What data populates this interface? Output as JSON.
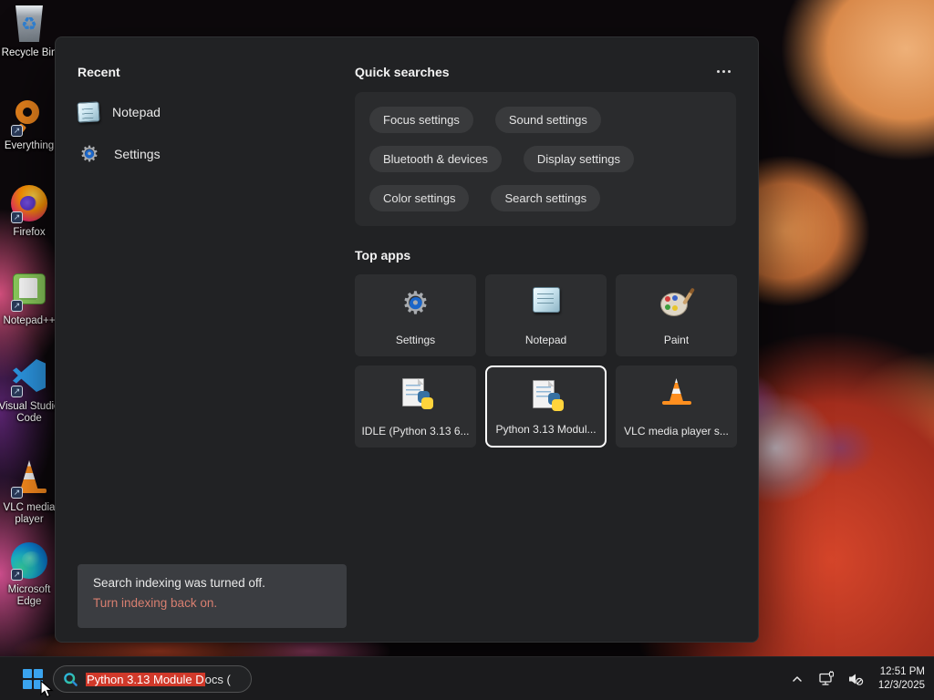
{
  "desktop": {
    "icons": [
      {
        "name": "recycle-bin",
        "label": "Recycle Bin"
      },
      {
        "name": "everything",
        "label": "Everything"
      },
      {
        "name": "firefox",
        "label": "Firefox"
      },
      {
        "name": "notepad-plus-plus",
        "label": "Notepad++"
      },
      {
        "name": "visual-studio-code",
        "label": "Visual Studio Code"
      },
      {
        "name": "vlc-media-player",
        "label": "VLC media player"
      },
      {
        "name": "microsoft-edge",
        "label": "Microsoft Edge"
      }
    ]
  },
  "panel": {
    "recent": {
      "title": "Recent",
      "items": [
        {
          "label": "Notepad"
        },
        {
          "label": "Settings"
        }
      ]
    },
    "quick_searches": {
      "title": "Quick searches",
      "pills": [
        "Focus settings",
        "Sound settings",
        "Bluetooth & devices",
        "Display settings",
        "Color settings",
        "Search settings"
      ]
    },
    "top_apps": {
      "title": "Top apps",
      "tiles": [
        {
          "label": "Settings",
          "selected": false
        },
        {
          "label": "Notepad",
          "selected": false
        },
        {
          "label": "Paint",
          "selected": false
        },
        {
          "label": "IDLE (Python 3.13 6...",
          "selected": false
        },
        {
          "label": "Python 3.13 Modul...",
          "selected": true
        },
        {
          "label": "VLC media player s...",
          "selected": false
        }
      ]
    },
    "notice": {
      "line1": "Search indexing was turned off.",
      "line2": "Turn indexing back on."
    }
  },
  "taskbar": {
    "search": {
      "highlighted_text": "Python 3.13 Module D",
      "rest_text": "ocs ("
    },
    "tray": {
      "time": "12:51 PM",
      "date": "12/3/2025"
    }
  },
  "colors": {
    "selection_highlight": "#d0392a",
    "notice_link": "#d87f70",
    "accent_blue": "#3aa3ee"
  }
}
